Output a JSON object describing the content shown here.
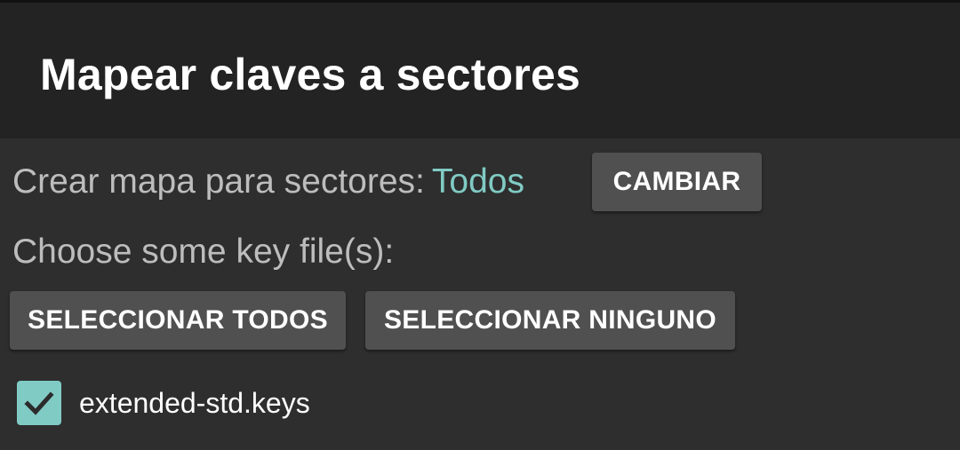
{
  "dialog": {
    "title": "Mapear claves a sectores"
  },
  "sectors": {
    "label": "Crear mapa para sectores:",
    "value": "Todos",
    "change_button": "CAMBIAR"
  },
  "key_files": {
    "label": "Choose some key file(s):",
    "select_all_button": "SELECCIONAR TODOS",
    "select_none_button": "SELECCIONAR NINGUNO",
    "items": [
      {
        "name": "extended-std.keys",
        "checked": true,
        "icon": "checkmark-icon"
      }
    ]
  },
  "colors": {
    "accent": "#80cbc4",
    "title_bar": "#232323",
    "background": "#2e2e2e",
    "button": "#505050"
  }
}
